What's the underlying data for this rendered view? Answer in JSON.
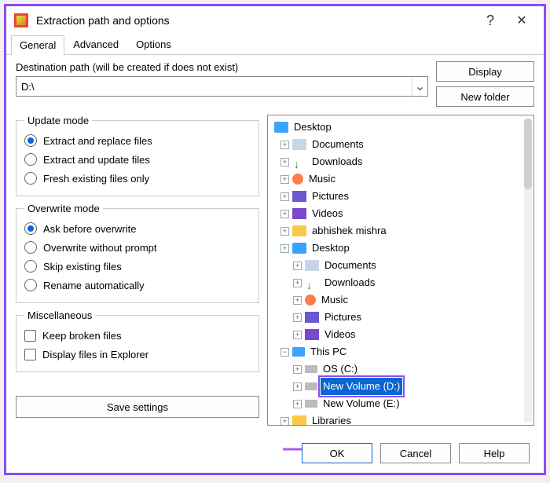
{
  "titlebar": {
    "title": "Extraction path and options"
  },
  "tabs": {
    "general": "General",
    "advanced": "Advanced",
    "options": "Options"
  },
  "dest": {
    "label": "Destination path (will be created if does not exist)",
    "value": "D:\\"
  },
  "buttons": {
    "display": "Display",
    "newfolder": "New folder",
    "save": "Save settings",
    "ok": "OK",
    "cancel": "Cancel",
    "help": "Help"
  },
  "updateMode": {
    "legend": "Update mode",
    "opt1": "Extract and replace files",
    "opt2": "Extract and update files",
    "opt3": "Fresh existing files only"
  },
  "overwriteMode": {
    "legend": "Overwrite mode",
    "opt1": "Ask before overwrite",
    "opt2": "Overwrite without prompt",
    "opt3": "Skip existing files",
    "opt4": "Rename automatically"
  },
  "misc": {
    "legend": "Miscellaneous",
    "opt1": "Keep broken files",
    "opt2": "Display files in Explorer"
  },
  "tree": {
    "desktop": "Desktop",
    "documents": "Documents",
    "downloads": "Downloads",
    "music": "Music",
    "pictures": "Pictures",
    "videos": "Videos",
    "abhishek": "abhishek mishra",
    "thispc": "This PC",
    "osc": "OS (C:)",
    "newd": "New Volume (D:)",
    "newe": "New Volume (E:)",
    "libraries": "Libraries"
  }
}
